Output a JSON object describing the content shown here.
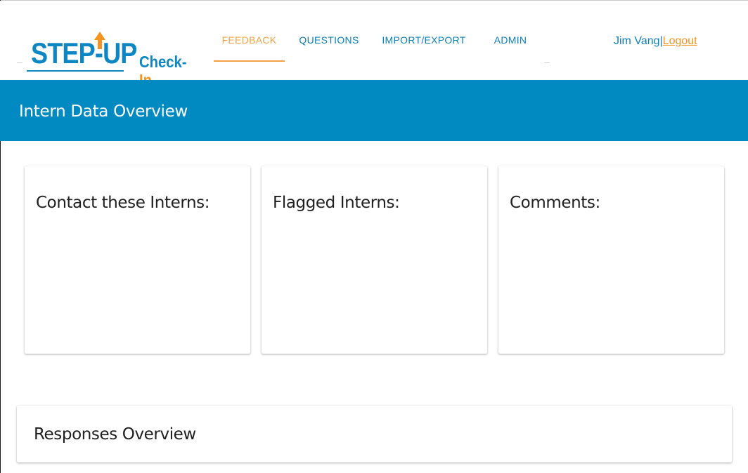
{
  "logo": {
    "step_up": "STEP-UP",
    "check": "Check-",
    "in": "In"
  },
  "nav": {
    "items": [
      {
        "label": "FEEDBACK",
        "active": true
      },
      {
        "label": "QUESTIONS",
        "active": false
      },
      {
        "label": "IMPORT/EXPORT",
        "active": false
      },
      {
        "label": "ADMIN",
        "active": false
      }
    ]
  },
  "user": {
    "name": "Jim Vang",
    "separator": "|",
    "logout_label": "Logout"
  },
  "banner": {
    "title": "Intern Data Overview"
  },
  "cards": [
    {
      "title": "Contact these Interns:"
    },
    {
      "title": "Flagged Interns:"
    },
    {
      "title": "Comments:"
    }
  ],
  "responses": {
    "title": "Responses Overview"
  },
  "colors": {
    "brand_blue": "#0189c2",
    "link_blue": "#0d7fb7",
    "accent_orange": "#f39320"
  }
}
